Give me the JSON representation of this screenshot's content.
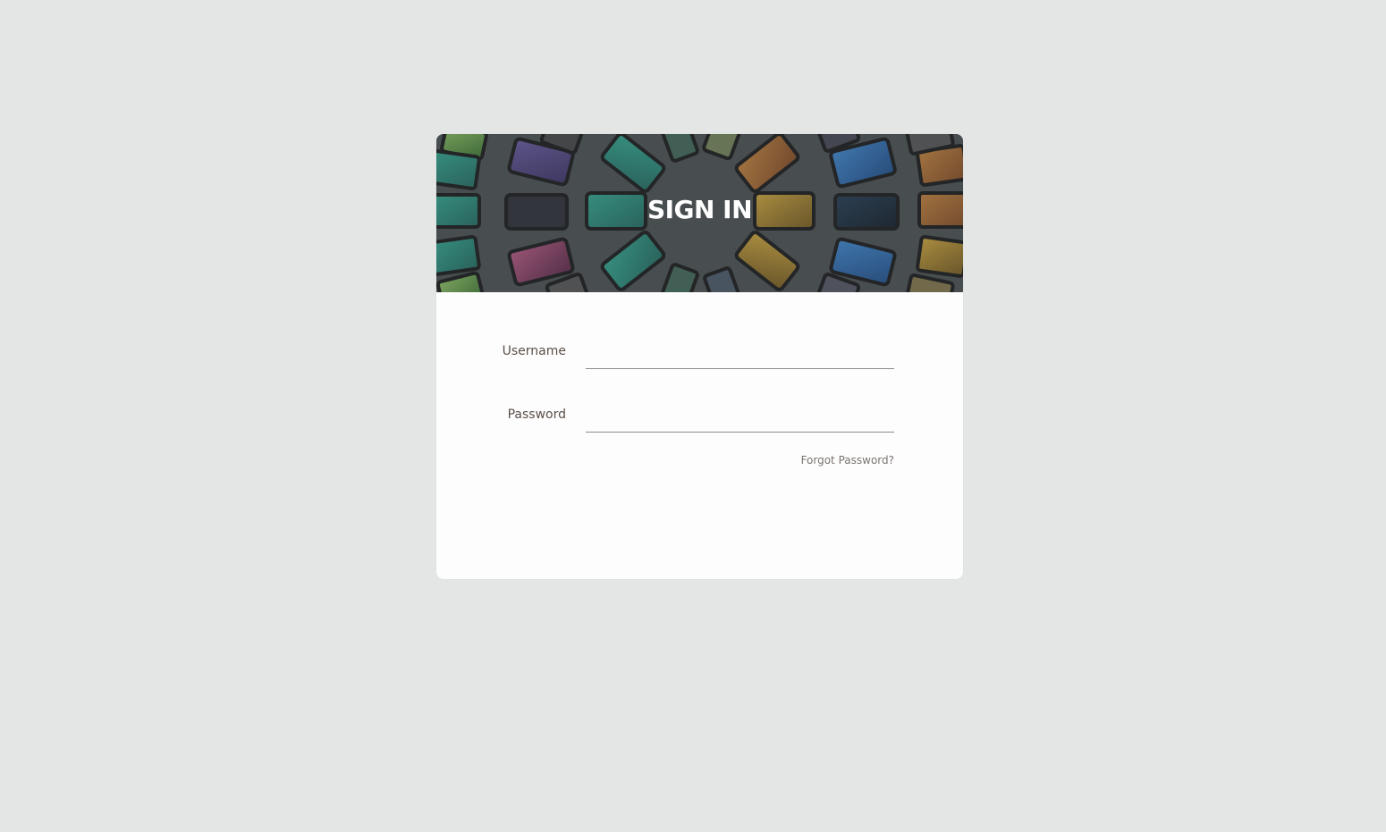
{
  "banner": {
    "title": "SIGN IN",
    "background_image": "radial-arrangement-of-smartphones"
  },
  "form": {
    "username_label": "Username",
    "username_value": "",
    "password_label": "Password",
    "password_value": "",
    "forgot_password_label": "Forgot Password?"
  },
  "colors": {
    "page_background": "#e4e6e6",
    "card_background": "#fdfdfd",
    "label_text": "#5a4f48",
    "link_text": "#7c7470",
    "input_underline": "#8c8c8c"
  }
}
